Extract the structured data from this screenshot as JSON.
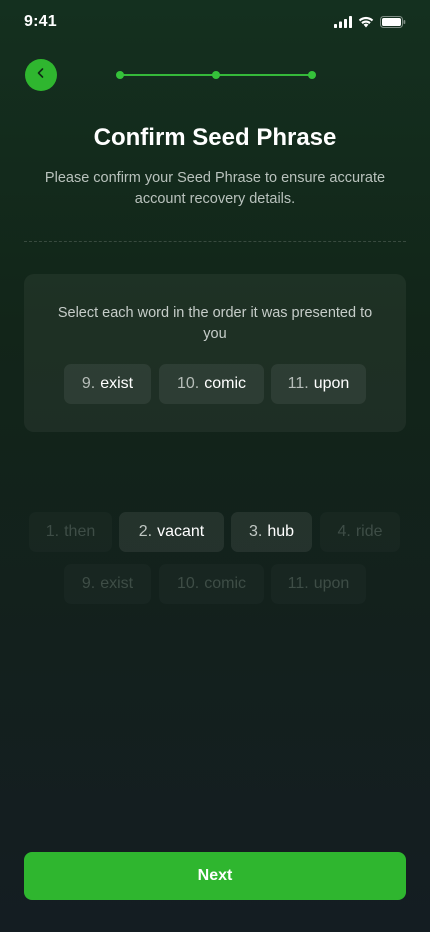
{
  "status_bar": {
    "time": "9:41",
    "icons": [
      "cellular-signal-icon",
      "wifi-icon",
      "battery-icon"
    ]
  },
  "header": {
    "back_icon": "chevron-left-icon",
    "progress_steps_total": 3,
    "progress_steps_complete": 3
  },
  "title": "Confirm Seed Phrase",
  "subtitle": "Please confirm your Seed Phrase to ensure accurate account recovery details.",
  "selected_panel": {
    "instruction": "Select each word in the order it was presented to you",
    "words": [
      {
        "num": "9.",
        "word": "exist"
      },
      {
        "num": "10.",
        "word": "comic"
      },
      {
        "num": "11.",
        "word": "upon"
      }
    ]
  },
  "word_bank": {
    "row1": [
      {
        "num": "1.",
        "word": "then",
        "state": "used"
      },
      {
        "num": "2.",
        "word": "vacant",
        "state": "available"
      },
      {
        "num": "3.",
        "word": "hub",
        "state": "available"
      },
      {
        "num": "4.",
        "word": "ride",
        "state": "used"
      }
    ],
    "row2": [
      {
        "num": "9.",
        "word": "exist",
        "state": "used"
      },
      {
        "num": "10.",
        "word": "comic",
        "state": "used"
      },
      {
        "num": "11.",
        "word": "upon",
        "state": "used"
      }
    ]
  },
  "next_button": {
    "label": "Next"
  },
  "colors": {
    "accent": "#2fb62f",
    "background_top": "#14301f",
    "background_bottom": "#141d22"
  }
}
